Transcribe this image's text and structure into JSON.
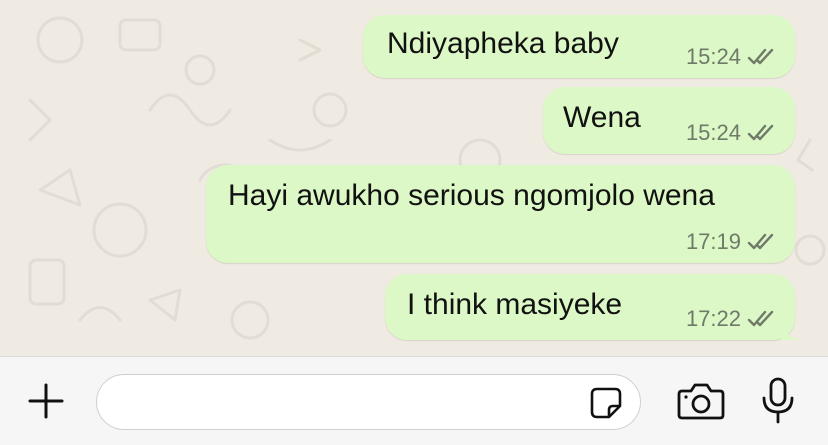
{
  "theme": {
    "wallpaper_color": "#efeae2",
    "bubble_outgoing": "#dcf8c6",
    "tick_color": "#6f7a68",
    "bar_color": "#f6f6f6"
  },
  "messages": [
    {
      "text": "Ndiyapheka baby",
      "time": "15:24",
      "status": "read-double-tick"
    },
    {
      "text": "Wena",
      "time": "15:24",
      "status": "read-double-tick"
    },
    {
      "text": "Hayi awukho serious ngomjolo wena",
      "time": "17:19",
      "status": "read-double-tick"
    },
    {
      "text": "I think masiyeke",
      "time": "17:22",
      "status": "read-double-tick"
    }
  ],
  "composer": {
    "input_value": "",
    "input_placeholder": "",
    "icons": [
      "plus-icon",
      "sticker-icon",
      "camera-icon",
      "microphone-icon"
    ]
  }
}
